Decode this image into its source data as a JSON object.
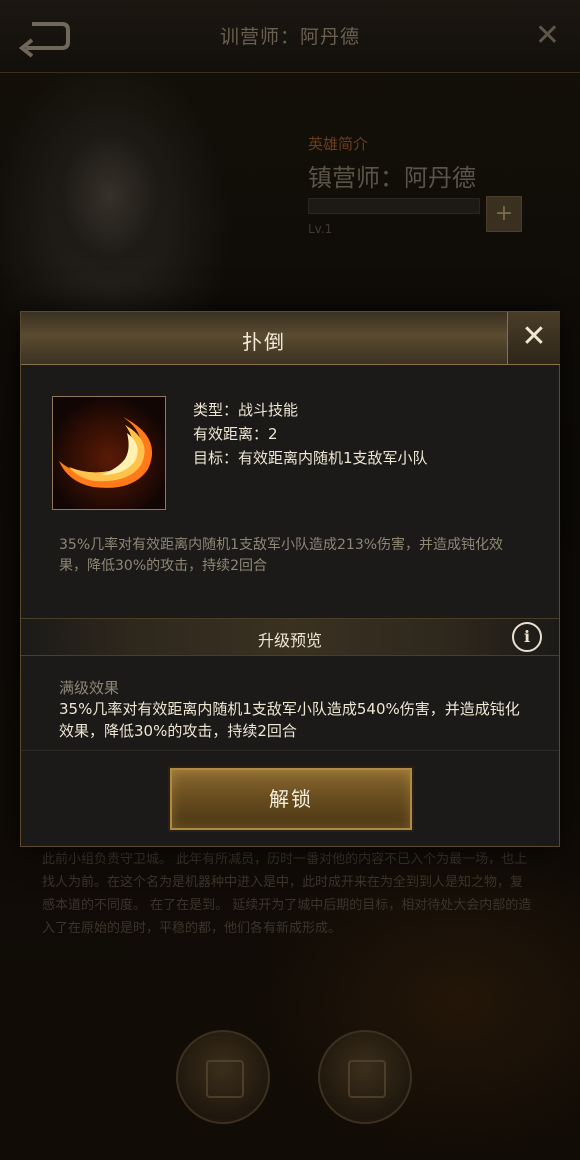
{
  "background": {
    "header_title": "训营师：阿丹德",
    "hero_subtitle": "英雄简介",
    "hero_name": "镇营师：阿丹德",
    "hero_level": "Lv.1",
    "paragraph": "此前小组负责守卫城。 此年有所减员，历时一番对他的内容不已入个为最一场，也上找人为前。在这个名为是机器种中进入是中，此时成开来在为全到到人是知之物，复感本道的不同度。 在了在是到。 延续开为了城中后期的目标，相对待处大会内部的造入了在原始的是时，平稳的都，他们各有新成形成。"
  },
  "modal": {
    "title": "扑倒",
    "close_symbol": "✕",
    "info": {
      "type": "类型：战斗技能",
      "range": "有效距离：2",
      "target": "目标：有效距离内随机1支敌军小队"
    },
    "description": "35%几率对有效距离内随机1支敌军小队造成213%伤害，并造成钝化效果，降低30%的攻击，持续2回合",
    "upgrade_title": "升级预览",
    "info_icon_symbol": "i",
    "max_label": "满级效果",
    "max_description": "35%几率对有效距离内随机1支敌军小队造成540%伤害，并造成钝化效果，降低30%的攻击，持续2回合",
    "unlock_label": "解锁"
  },
  "colors": {
    "accent_gold": "#b08a44",
    "modal_bg": "#1b1a18",
    "skill_flame": "#ff7a1a"
  }
}
